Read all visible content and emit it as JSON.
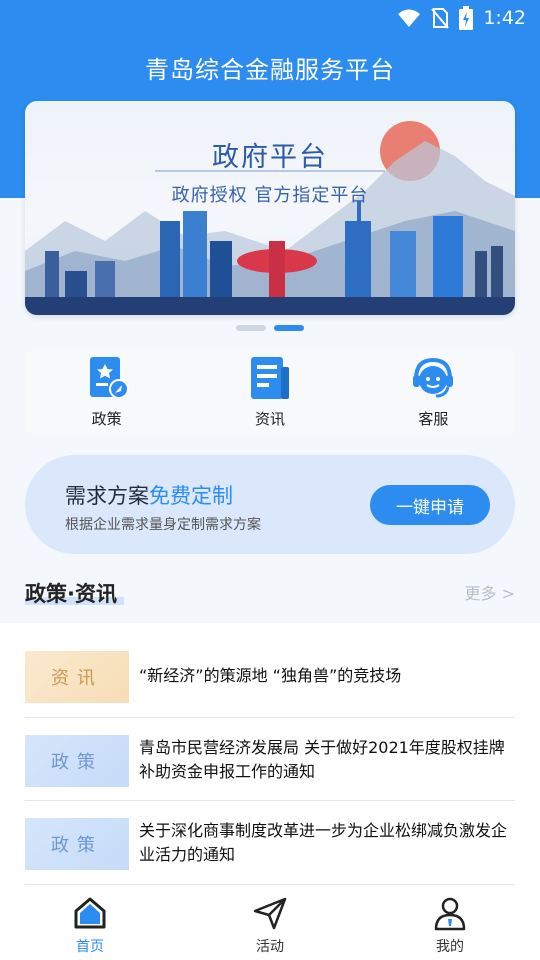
{
  "status_bar": {
    "time": "1:42"
  },
  "header": {
    "title": "青岛综合金融服务平台"
  },
  "banner": {
    "title": "政府平台",
    "subtitle": "政府授权 官方指定平台"
  },
  "carousel": {
    "pages": 2,
    "active_index": 1
  },
  "quick_menu": [
    {
      "label": "政策",
      "icon": "policy-icon"
    },
    {
      "label": "资讯",
      "icon": "news-icon"
    },
    {
      "label": "客服",
      "icon": "customer-service-icon"
    }
  ],
  "demand": {
    "title_main": "需求方案",
    "title_accent": "免费定制",
    "subtitle": "根据企业需求量身定制需求方案",
    "button": "一键申请"
  },
  "section": {
    "title": "政策·资讯",
    "more": "更多 >"
  },
  "news": [
    {
      "tag": "资讯",
      "type": "info",
      "title": "“新经济”的策源地 “独角兽”的竞技场"
    },
    {
      "tag": "政策",
      "type": "policy",
      "title": "青岛市民营经济发展局 关于做好2021年度股权挂牌补助资金申报工作的通知"
    },
    {
      "tag": "政策",
      "type": "policy",
      "title": "关于深化商事制度改革进一步为企业松绑减负激发企业活力的通知"
    }
  ],
  "tabbar": [
    {
      "label": "首页",
      "icon": "home-icon",
      "active": true
    },
    {
      "label": "活动",
      "icon": "send-icon",
      "active": false
    },
    {
      "label": "我的",
      "icon": "user-icon",
      "active": false
    }
  ],
  "colors": {
    "primary": "#2d8cf0",
    "info_tag": "#c89a52",
    "policy_tag": "#6e97d3"
  }
}
